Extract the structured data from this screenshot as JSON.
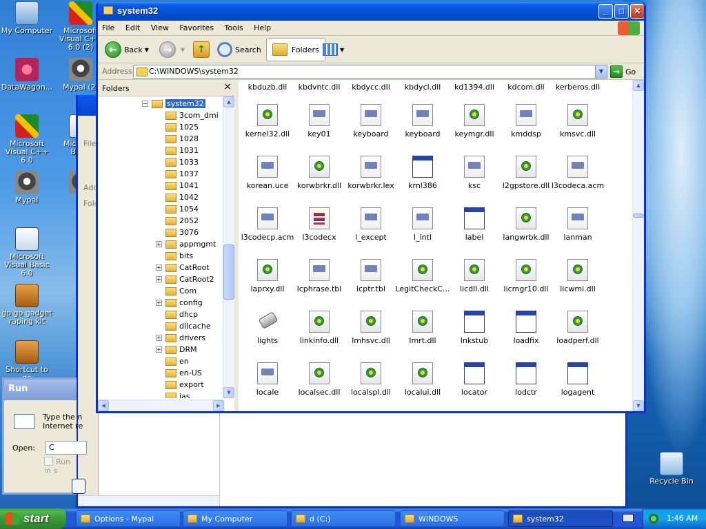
{
  "desktop": {
    "icons": [
      {
        "label": "My Computer",
        "icon": "computer-icon"
      },
      {
        "label": "Microsoft Visual C++ 6.0 (2)",
        "icon": "visual-cpp-icon"
      },
      {
        "label": "DataWagon...",
        "icon": "datawagon-icon"
      },
      {
        "label": "Mypal (2)",
        "icon": "mypal-icon"
      },
      {
        "label": "Microsoft Visual C++ 6.0",
        "icon": "visual-cpp-icon"
      },
      {
        "label": "Microsoft Basic",
        "icon": "visual-basic-icon"
      },
      {
        "label": "Mypal",
        "icon": "mypal-icon"
      },
      {
        "label": "M",
        "icon": "mypal-icon"
      },
      {
        "label": "Microsoft Visual Basic 6.0",
        "icon": "visual-basic-icon"
      },
      {
        "label": "go go gadget raping kit",
        "icon": "briefcase-icon"
      },
      {
        "label": "Shortcut to go",
        "icon": "briefcase-icon"
      },
      {
        "label": "Recycle Bin",
        "icon": "recycle-bin-icon"
      }
    ]
  },
  "back_window": {
    "labels": [
      "File",
      "Add",
      "Fold"
    ]
  },
  "run_dialog": {
    "title": "Run",
    "description_line1": "Type the n",
    "description_line2": "Internet re",
    "open_label": "Open:",
    "open_value": "C",
    "checkbox_label": "Run in s"
  },
  "window": {
    "title": "system32",
    "menu": [
      "File",
      "Edit",
      "View",
      "Favorites",
      "Tools",
      "Help"
    ],
    "toolbar": {
      "back_label": "Back",
      "search_label": "Search",
      "folders_label": "Folders"
    },
    "address": {
      "label": "Address",
      "value": "C:\\WINDOWS\\system32",
      "go_label": "Go"
    },
    "folders_pane": {
      "title": "Folders",
      "close_glyph": "×",
      "items": [
        {
          "label": "system32",
          "expander": "−",
          "selected": true,
          "level": 0
        },
        {
          "label": "3com_dmi",
          "expander": "",
          "level": 1
        },
        {
          "label": "1025",
          "expander": "",
          "level": 1
        },
        {
          "label": "1028",
          "expander": "",
          "level": 1
        },
        {
          "label": "1031",
          "expander": "",
          "level": 1
        },
        {
          "label": "1033",
          "expander": "",
          "level": 1
        },
        {
          "label": "1037",
          "expander": "",
          "level": 1
        },
        {
          "label": "1041",
          "expander": "",
          "level": 1
        },
        {
          "label": "1042",
          "expander": "",
          "level": 1
        },
        {
          "label": "1054",
          "expander": "",
          "level": 1
        },
        {
          "label": "2052",
          "expander": "",
          "level": 1
        },
        {
          "label": "3076",
          "expander": "",
          "level": 1
        },
        {
          "label": "appmgmt",
          "expander": "+",
          "level": 1
        },
        {
          "label": "bits",
          "expander": "",
          "level": 1
        },
        {
          "label": "CatRoot",
          "expander": "+",
          "level": 1
        },
        {
          "label": "CatRoot2",
          "expander": "+",
          "level": 1
        },
        {
          "label": "Com",
          "expander": "",
          "level": 1
        },
        {
          "label": "config",
          "expander": "+",
          "level": 1
        },
        {
          "label": "dhcp",
          "expander": "",
          "level": 1
        },
        {
          "label": "dllcache",
          "expander": "",
          "level": 1
        },
        {
          "label": "drivers",
          "expander": "+",
          "level": 1
        },
        {
          "label": "DRM",
          "expander": "+",
          "level": 1
        },
        {
          "label": "en",
          "expander": "",
          "level": 1
        },
        {
          "label": "en-US",
          "expander": "",
          "level": 1
        },
        {
          "label": "export",
          "expander": "",
          "level": 1
        },
        {
          "label": "ias",
          "expander": "",
          "level": 1
        }
      ]
    },
    "files": [
      {
        "name": "kbduzb.dll",
        "type": "none"
      },
      {
        "name": "kbdvntc.dll",
        "type": "none"
      },
      {
        "name": "kbdycc.dll",
        "type": "none"
      },
      {
        "name": "kbdycl.dll",
        "type": "none"
      },
      {
        "name": "kd1394.dll",
        "type": "none"
      },
      {
        "name": "kdcom.dll",
        "type": "none"
      },
      {
        "name": "kerberos.dll",
        "type": "none"
      },
      {
        "name": "kernel32.dll",
        "type": "dll"
      },
      {
        "name": "key01",
        "type": "doc"
      },
      {
        "name": "keyboard",
        "type": "doc"
      },
      {
        "name": "keyboard",
        "type": "doc"
      },
      {
        "name": "keymgr.dll",
        "type": "dll"
      },
      {
        "name": "kmddsp",
        "type": "doc"
      },
      {
        "name": "kmsvc.dll",
        "type": "dll"
      },
      {
        "name": "korean.uce",
        "type": "doc"
      },
      {
        "name": "korwbrkr.dll",
        "type": "dll"
      },
      {
        "name": "korwbrkr.lex",
        "type": "doc"
      },
      {
        "name": "krnl386",
        "type": "app"
      },
      {
        "name": "ksc",
        "type": "doc"
      },
      {
        "name": "l2gpstore.dll",
        "type": "dll"
      },
      {
        "name": "l3codeca.acm",
        "type": "doc"
      },
      {
        "name": "l3codecp.acm",
        "type": "doc"
      },
      {
        "name": "l3codecx",
        "type": "cpl"
      },
      {
        "name": "l_except",
        "type": "doc"
      },
      {
        "name": "l_intl",
        "type": "doc"
      },
      {
        "name": "label",
        "type": "app"
      },
      {
        "name": "langwrbk.dll",
        "type": "dll"
      },
      {
        "name": "lanman",
        "type": "doc"
      },
      {
        "name": "laprxy.dll",
        "type": "dll"
      },
      {
        "name": "lcphrase.tbl",
        "type": "doc"
      },
      {
        "name": "lcptr.tbl",
        "type": "doc"
      },
      {
        "name": "LegitCheckC...",
        "type": "dll"
      },
      {
        "name": "licdll.dll",
        "type": "dll"
      },
      {
        "name": "licmgr10.dll",
        "type": "dll"
      },
      {
        "name": "licwmi.dll",
        "type": "dll"
      },
      {
        "name": "lights",
        "type": "plug"
      },
      {
        "name": "linkinfo.dll",
        "type": "dll"
      },
      {
        "name": "lmhsvc.dll",
        "type": "dll"
      },
      {
        "name": "lmrt.dll",
        "type": "dll"
      },
      {
        "name": "lnkstub",
        "type": "app"
      },
      {
        "name": "loadfix",
        "type": "app"
      },
      {
        "name": "loadperf.dll",
        "type": "dll"
      },
      {
        "name": "locale",
        "type": "doc"
      },
      {
        "name": "localsec.dll",
        "type": "dll"
      },
      {
        "name": "localspl.dll",
        "type": "dll"
      },
      {
        "name": "localui.dll",
        "type": "dll"
      },
      {
        "name": "locator",
        "type": "app"
      },
      {
        "name": "lodctr",
        "type": "app"
      },
      {
        "name": "logagent",
        "type": "app"
      }
    ]
  },
  "taskbar": {
    "start_label": "start",
    "tasks": [
      {
        "label": "Options - Mypal",
        "active": false
      },
      {
        "label": "My Computer",
        "active": false
      },
      {
        "label": "d (C:)",
        "active": false
      },
      {
        "label": "WINDOWS",
        "active": false
      },
      {
        "label": "system32",
        "active": true
      }
    ],
    "clock": "1:46 AM"
  }
}
